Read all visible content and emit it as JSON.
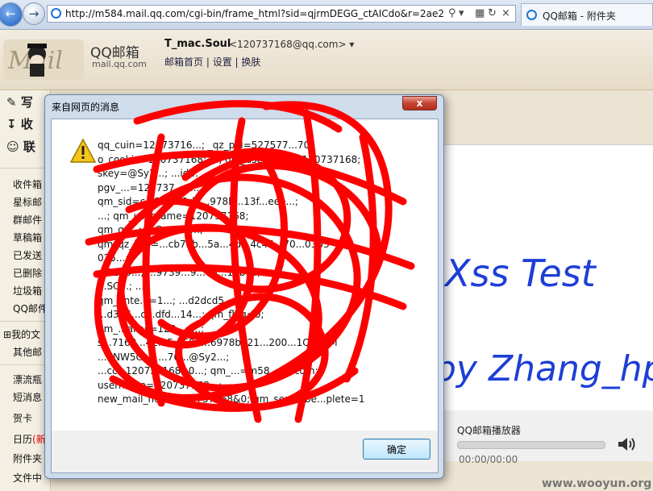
{
  "browser": {
    "url": "http://m584.mail.qq.com/cgi-bin/frame_html?sid=qjrmDEGG_ctAICdo&r=2ae2f087",
    "tab_title": "QQ邮箱 - 附件夹"
  },
  "header": {
    "brand": "QQ邮箱",
    "domain": "mail.qq.com",
    "user_name": "T_mac.Soul",
    "user_email": "<120737168@qq.com>",
    "links": [
      "邮箱首页",
      "设置",
      "换肤"
    ]
  },
  "sidebar": {
    "actions": [
      "写",
      "收",
      "联"
    ],
    "folders": [
      "收件箱",
      "星标邮",
      "群邮件",
      "草稿箱",
      "已发送",
      "已删除",
      "垃圾箱",
      "QQ邮件",
      "我的文",
      "其他邮",
      "漂流瓶",
      "短消息",
      "贺卡",
      "日历",
      "附件夹",
      "文件中"
    ],
    "calendar_badge": "(新"
  },
  "content": {
    "line1": "Xss Test",
    "line2": "by Zhang_hp"
  },
  "player": {
    "title": "QQ邮箱播放器",
    "time": "00:00/00:00",
    "progress": 0
  },
  "dialog": {
    "title": "来自网页的消息",
    "close_label": "x",
    "message_lines": [
      "qq_cuin=12073716...; _qz_pkl=527577...70;",
      "o_cookie=120737168; ...; qm_username=120737168;",
      "skey=@Sy2...; ...id...",
      "pgv_...=120737...; ...;",
      "qm_sid=c...227...1d5...978b...13f...eee...;",
      "...; qm_username=120737168;",
      "qm_qz...; ...@qq.com;",
      "qm_qz_key=...cb70b...5a...4d...4c45...70...0303",
      "025...;",
      "...1200...; ...9739...9...45...17bea;",
      "...SC...; ...",
      "qm_ante...=1...; ...d2dcd5",
      "...d356...c...dfd...14...; qm_flag=0;",
      "qm_...alias=120...; ...;",
      "s...7168...42...5...697...6978b621...200...1QFN5M",
      "...5NW5C...; ...76...@Sy2...;",
      "...cc=120737168&0...; qm_...=m58...qq.com;",
      "username=120737168...;",
      "new_mail_num=120737168&0; qm_sendwbe...plete=1"
    ],
    "ok_label": "确定"
  },
  "watermark": "www.wooyun.org"
}
